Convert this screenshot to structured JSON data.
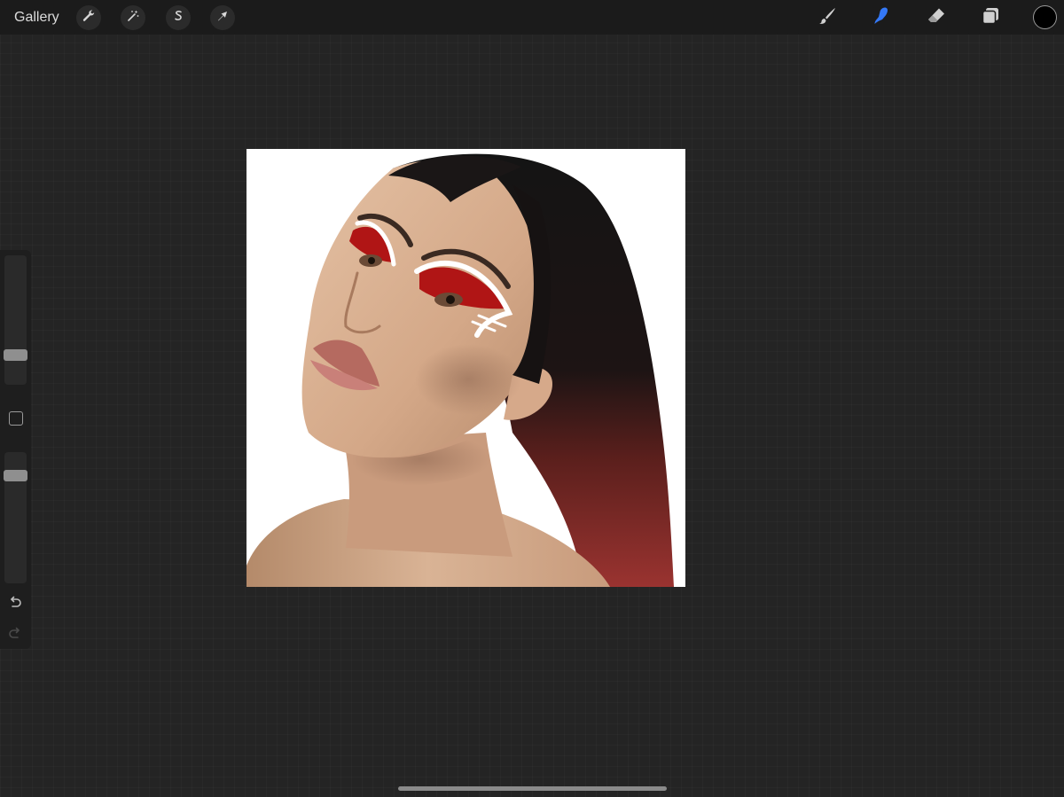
{
  "toolbar": {
    "gallery_label": "Gallery",
    "left_tools": [
      {
        "name": "actions",
        "icon": "wrench-icon"
      },
      {
        "name": "adjustments",
        "icon": "magic-wand-icon"
      },
      {
        "name": "selection",
        "icon": "selection-s-icon"
      },
      {
        "name": "transform",
        "icon": "arrow-cursor-icon"
      }
    ],
    "right_tools": [
      {
        "name": "brush",
        "icon": "brush-icon",
        "active": false
      },
      {
        "name": "smudge",
        "icon": "smudge-finger-icon",
        "active": true
      },
      {
        "name": "eraser",
        "icon": "eraser-icon",
        "active": false
      },
      {
        "name": "layers",
        "icon": "layers-icon",
        "active": false
      }
    ],
    "active_color": "#000000",
    "accent_color": "#3478f6"
  },
  "sidebar": {
    "brush_size_level": 0.2,
    "opacity_level": 0.85,
    "modify_icon": "square-icon",
    "undo_icon": "undo-icon",
    "redo_icon": "redo-icon"
  },
  "canvas": {
    "artwork": "portrait-painting-icon"
  }
}
